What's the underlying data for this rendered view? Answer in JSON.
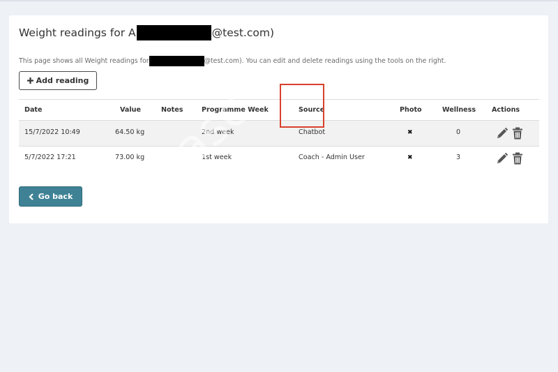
{
  "page": {
    "title_prefix": "Weight readings for A",
    "title_suffix": "@test.com)",
    "desc_prefix": "This page shows all Weight readings for",
    "desc_suffix": "@test.com). You can edit and delete readings using the tools on the right.",
    "add_button_label": "Add reading",
    "back_button_label": "Go back",
    "watermark": "barasc"
  },
  "table": {
    "headers": {
      "date": "Date",
      "value": "Value",
      "notes": "Notes",
      "week": "Programme Week",
      "source": "Source",
      "photo": "Photo",
      "wellness": "Wellness",
      "actions": "Actions"
    },
    "rows": [
      {
        "date": "15/7/2022 10:49",
        "value": "64.50 kg",
        "notes": "",
        "week": "2nd week",
        "source": "Chatbot",
        "photo": "✖",
        "wellness": "0"
      },
      {
        "date": "5/7/2022 17:21",
        "value": "73.00 kg",
        "notes": "",
        "week": "1st week",
        "source": "Coach - Admin User",
        "photo": "✖",
        "wellness": "3"
      }
    ]
  },
  "icons": {
    "add": "plus-icon",
    "back": "chevron-left-icon",
    "edit": "pencil-icon",
    "delete": "trash-icon",
    "photo_missing": "cross-icon"
  },
  "colors": {
    "primary": "#3f8295",
    "highlight": "#d9402c",
    "background": "#eef1f6"
  }
}
